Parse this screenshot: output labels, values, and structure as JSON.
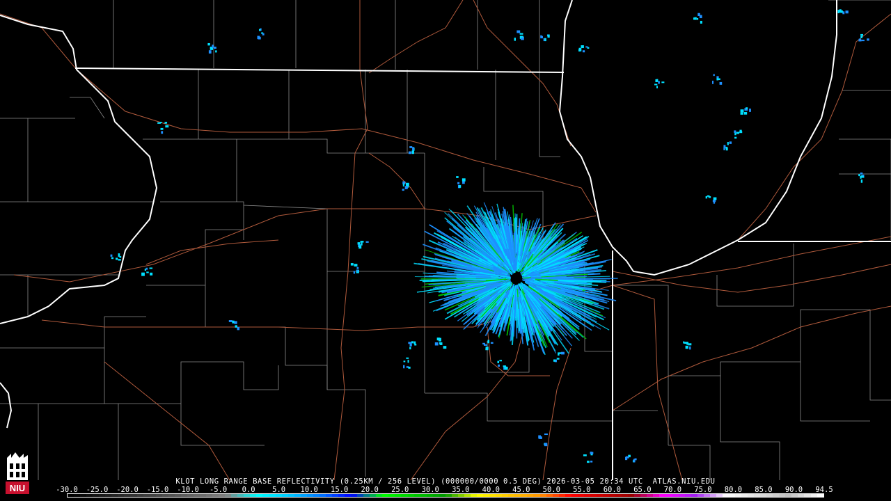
{
  "product": {
    "caption": "KLOT LONG RANGE BASE REFLECTIVITY (0.25KM / 256 LEVEL) (000000/0000 0.5 DEG) 2026-03-05 20:34 UTC  ATLAS.NIU.EDU",
    "radar_site": "KLOT",
    "timestamp": "2026-03-05 20:34 UTC",
    "source": "ATLAS.NIU.EDU"
  },
  "logo": {
    "text": "NIU",
    "color": "#c8102e"
  },
  "legend": {
    "unit": "",
    "labels": [
      "-30.0",
      "-25.0",
      "-20.0",
      "-15.0",
      "-10.0",
      "-5.0",
      "0.0",
      "5.0",
      "10.0",
      "15.0",
      "20.0",
      "25.0",
      "30.0",
      "35.0",
      "40.0",
      "45.0",
      "50.0",
      "55.0",
      "60.0",
      "65.0",
      "70.0",
      "75.0",
      "80.0",
      "85.0",
      "90.0",
      "94.5"
    ],
    "colors": [
      "#000000",
      "#1a1a1a",
      "#333333",
      "#4d4d4d",
      "#666666",
      "#808080",
      "#00ffff",
      "#00c8ff",
      "#0078ff",
      "#0000ff",
      "#00ff00",
      "#00c800",
      "#009600",
      "#ffff00",
      "#ffc800",
      "#ff9600",
      "#ff0000",
      "#c80000",
      "#960000",
      "#ff00ff",
      "#a020f0",
      "#ffffff",
      "#e0e0e0",
      "#c0c0c0",
      "#ffffff"
    ]
  },
  "map_colors": {
    "background": "#000000",
    "state_border": "#ffffff",
    "county_border": "#8c8c8c",
    "highway": "#b05a3c",
    "echo_light": "#00e0ff",
    "echo_mid": "#1e90ff",
    "echo_strong": "#00c800"
  }
}
